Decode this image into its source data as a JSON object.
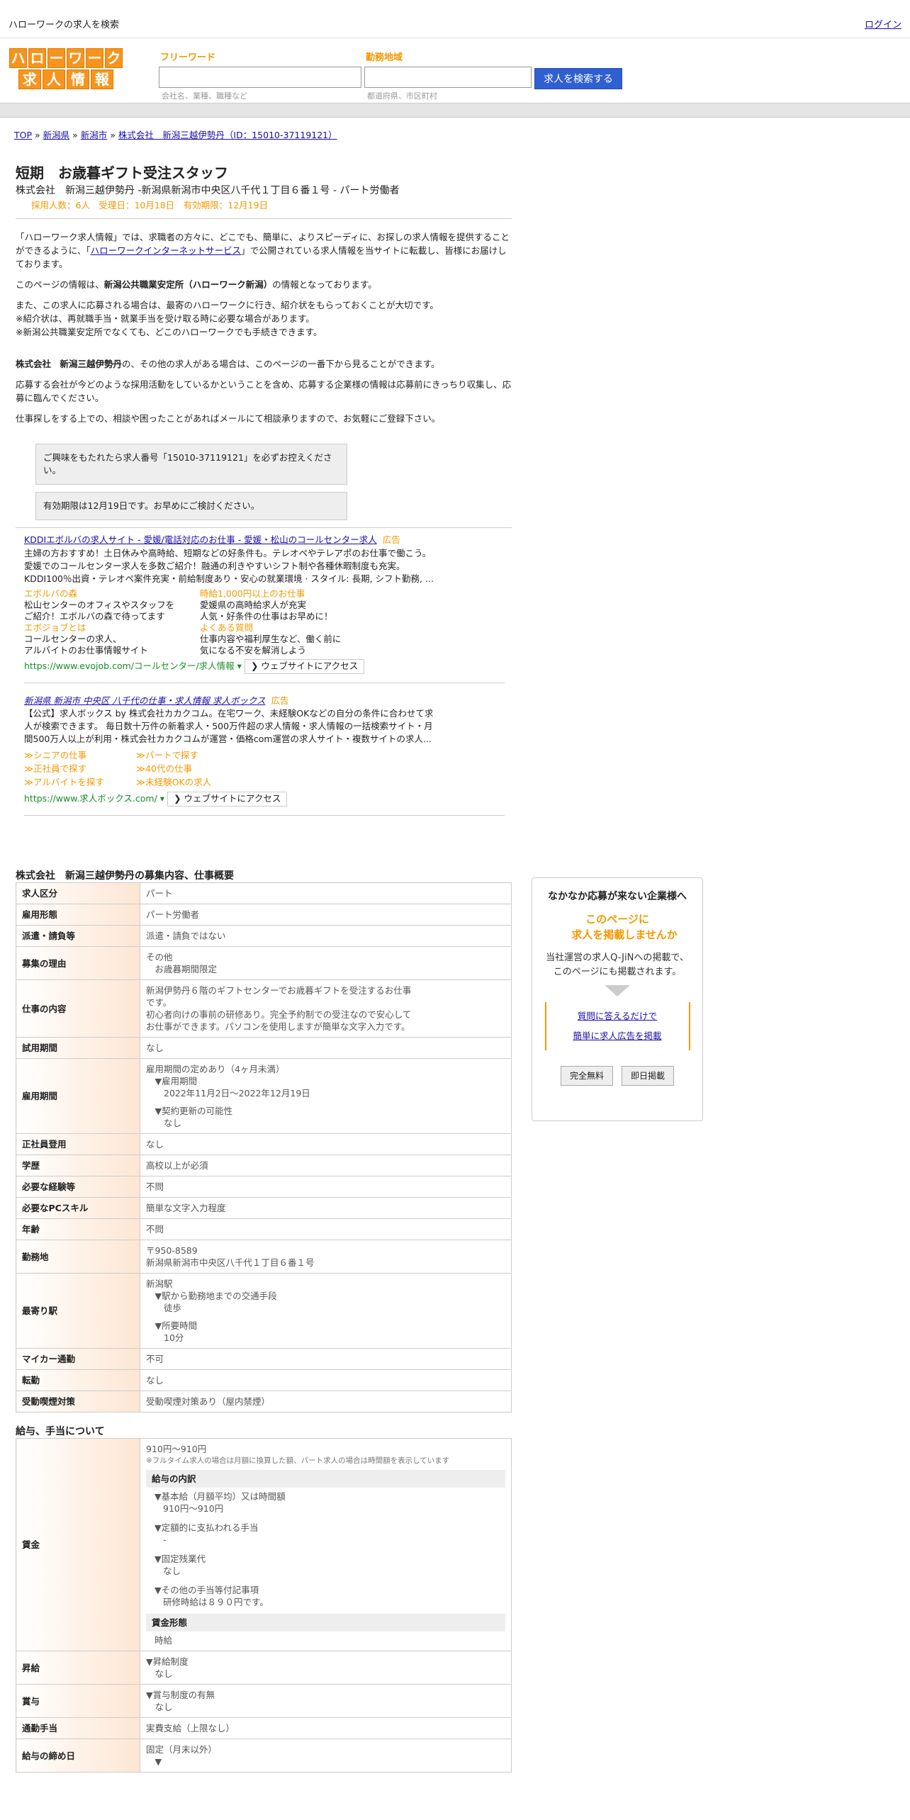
{
  "topbar": {
    "site_title": "ハローワークの求人を検索",
    "login": "ログイン"
  },
  "logo": {
    "row1": [
      "ハ",
      "ロ",
      "ー",
      "ワ",
      "ー",
      "ク"
    ],
    "row2": [
      "求",
      "人",
      "情",
      "報"
    ]
  },
  "search": {
    "free_label": "フリーワード",
    "free_hint": "会社名、業種、職種など",
    "area_label": "勤務地域",
    "area_hint": "都道府県、市区町村",
    "button": "求人を検索する"
  },
  "breadcrumb": {
    "top": "TOP",
    "sep": "»",
    "pref": "新潟県",
    "city": "新潟市",
    "current": "株式会社　新潟三越伊勢丹（ID：15010-37119121）"
  },
  "job": {
    "title": "短期　お歳暮ギフト受注スタッフ",
    "subtitle": "株式会社　新潟三越伊勢丹 -新潟県新潟市中央区八千代１丁目６番１号 - パート労働者",
    "meta": "採用人数：6人　受理日：10月18日　有効期限：12月19日"
  },
  "intro": {
    "p1a": "「ハローワーク求人情報」では、求職者の方々に、どこでも、簡単に、よりスピーディに、お探しの求人情報を提供することができるように、「",
    "p1link": "ハローワークインターネットサービス",
    "p1b": "」で公開されている求人情報を当サイトに転載し、皆様にお届けしております。",
    "p2a": "このページの情報は、",
    "p2b": "新潟公共職業安定所（ハローワーク新潟）",
    "p2c": "の情報となっております。",
    "p3": [
      "また、この求人に応募される場合は、最寄のハローワークに行き、紹介状をもらっておくことが大切です。",
      "※紹介状は、再就職手当・就業手当を受け取る時に必要な場合があります。",
      "※新潟公共職業安定所でなくても、どこのハローワークでも手続きできます。"
    ],
    "p4a": "株式会社　新潟三越伊勢丹",
    "p4b": "の、その他の求人がある場合は、このページの一番下から見ることができます。",
    "p5": "応募する会社が今どのような採用活動をしているかということを含め、応募する企業様の情報は応募前にきっちり収集し、応募に臨んでください。",
    "p6": "仕事探しをする上での、相談や困ったことがあればメールにて相談承りますので、お気軽にご登録下さい。",
    "note1": "ご興味をもたれたら求人番号「15010-37119121」を必ずお控えください。",
    "note2": "有効期限は12月19日です。お早めにご検討ください。"
  },
  "ad1": {
    "title": "KDDIエボルバの求人サイト - 愛媛/電話対応のお仕事 - 愛媛・松山のコールセンター求人",
    "label": "広告",
    "desc": [
      "主婦の方おすすめ！土日休みや高時給、短期などの好条件も。テレオペやテレアポのお仕事で働こう。",
      "愛媛でのコールセンター求人を多数ご紹介！融通の利きやすいシフト制や各種休暇制度も充実。",
      "KDDI100％出資・テレオペ案件充実・前給制度あり・安心の就業環境 · スタイル: 長期, シフト勤務, ..."
    ],
    "links": [
      {
        "t": "エボルバの森",
        "d": [
          "松山センターのオフィスやスタッフを",
          "ご紹介！エボルバの森で待ってます"
        ]
      },
      {
        "t": "時給1,000円以上のお仕事",
        "d": [
          "愛媛県の高時給求人が充実",
          "人気・好条件の仕事はお早めに！"
        ]
      },
      {
        "t": "エボジョブとは",
        "d": [
          "コールセンターの求人、",
          "アルバイトのお仕事情報サイト"
        ]
      },
      {
        "t": "よくある質問",
        "d": [
          "仕事内容や福利厚生など、働く前に",
          "気になる不安を解消しよう"
        ]
      }
    ],
    "url": "https://www.evojob.com/コールセンター/求人情報 ▾",
    "go": "❯ ウェブサイトにアクセス"
  },
  "ad2": {
    "title": "新潟県 新潟市 中央区 八千代の仕事・求人情報 求人ボックス",
    "label": "広告",
    "desc": [
      "【公式】求人ボックス by 株式会社カカクコム。在宅ワーク、未経験OKなどの自分の条件に合わせて求",
      "人が検索できます。 毎日数十万件の新着求人・500万件超の求人情報・求人情報の一括検索サイト・月",
      "間500万人以上が利用・株式会社カカクコムが運営・価格com運営の求人サイト・複数サイトの求人..."
    ],
    "links": [
      "≫シニアの仕事",
      "≫パートで探す",
      "≫正社員で探す",
      "≫40代の仕事",
      "≫アルバイトを探す",
      "≫未経験OKの求人"
    ],
    "url": "https://www.求人ボックス.com/ ▾",
    "go": "❯ ウェブサイトにアクセス"
  },
  "section1": {
    "heading": "株式会社　新潟三越伊勢丹の募集内容、仕事概要",
    "rows": [
      {
        "k": "求人区分",
        "v": [
          "パート"
        ]
      },
      {
        "k": "雇用形態",
        "v": [
          "パート労働者"
        ]
      },
      {
        "k": "派遣・請負等",
        "v": [
          "派遣・請負ではない"
        ]
      },
      {
        "k": "募集の理由",
        "v": [
          "その他",
          "　お歳暮期間限定"
        ]
      },
      {
        "k": "仕事の内容",
        "v": [
          "新潟伊勢丹６階のギフトセンターでお歳暮ギフトを受注するお仕事",
          "です。",
          "初心者向けの事前の研修あり。完全予約制での受注なので安心して",
          "お仕事ができます。パソコンを使用しますが簡単な文字入力です。"
        ]
      },
      {
        "k": "試用期間",
        "v": [
          "なし"
        ]
      },
      {
        "k": "雇用期間",
        "v": [
          "雇用期間の定めあり（4ヶ月未満）",
          "　▼雇用期間",
          "　　2022年11月2日〜2022年12月19日",
          "",
          "　▼契約更新の可能性",
          "　　なし"
        ]
      },
      {
        "k": "正社員登用",
        "v": [
          "なし"
        ]
      },
      {
        "k": "学歴",
        "v": [
          "高校以上が必須"
        ]
      },
      {
        "k": "必要な経験等",
        "v": [
          "不問"
        ]
      },
      {
        "k": "必要なPCスキル",
        "v": [
          "簡単な文字入力程度"
        ]
      },
      {
        "k": "年齢",
        "v": [
          "不問"
        ]
      },
      {
        "k": "勤務地",
        "v": [
          "〒950-8589",
          "新潟県新潟市中央区八千代１丁目６番１号"
        ]
      },
      {
        "k": "最寄り駅",
        "v": [
          "新潟駅",
          "　▼駅から勤務地までの交通手段",
          "　　徒歩",
          "",
          "　▼所要時間",
          "　　10分"
        ]
      },
      {
        "k": "マイカー通勤",
        "v": [
          "不可"
        ]
      },
      {
        "k": "転勤",
        "v": [
          "なし"
        ]
      },
      {
        "k": "受動喫煙対策",
        "v": [
          "受動喫煙対策あり（屋内禁煙）"
        ]
      }
    ]
  },
  "section2": {
    "heading": "給与、手当について",
    "wage_key": "賃金",
    "wage_range": "910円〜910円",
    "wage_note": "※フルタイム求人の場合は月額に換算した額、パート求人の場合は時間額を表示しています",
    "breakdown_title": "給与の内訳",
    "breakdown": [
      [
        "▼基本給（月額平均）又は時間額",
        "910円〜910円"
      ],
      [
        "▼定額的に支払われる手当",
        "-"
      ],
      [
        "▼固定残業代",
        "なし"
      ],
      [
        "▼その他の手当等付記事項",
        "研修時給は８９０円です。"
      ]
    ],
    "form_title": "賃金形態",
    "form_value": "時給",
    "rows": [
      {
        "k": "昇給",
        "v": [
          "▼昇給制度",
          "　なし"
        ]
      },
      {
        "k": "賞与",
        "v": [
          "▼賞与制度の有無",
          "　なし"
        ]
      },
      {
        "k": "通勤手当",
        "v": [
          "実費支給（上限なし）"
        ]
      },
      {
        "k": "給与の締め日",
        "v": [
          "固定（月末以外）",
          "　▼"
        ]
      }
    ]
  },
  "side": {
    "title": "なかなか応募が来ない企業様へ",
    "hl1": "このページに",
    "hl2": "求人を掲載しませんか",
    "desc1": "当社運営の求人Q-JiNへの掲載で、",
    "desc2": "このページにも掲載されます。",
    "link1": "質問に答えるだけで",
    "link2": "簡単に求人広告を掲載",
    "btn1": "完全無料",
    "btn2": "即日掲載"
  }
}
